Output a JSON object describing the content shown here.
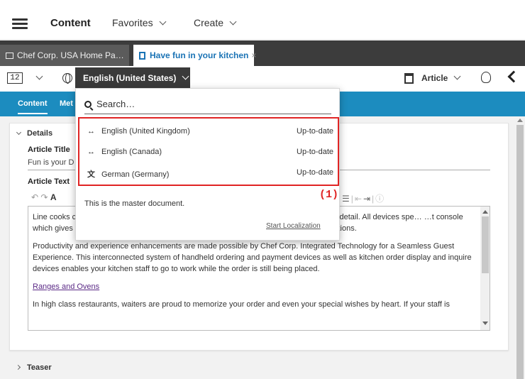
{
  "topnav": {
    "title": "Content",
    "favorites_label": "Favorites",
    "create_label": "Create"
  },
  "tabs": [
    {
      "label": "Chef Corp. USA Home Pa…"
    },
    {
      "label": "Have fun in your kitchen",
      "close": "×"
    }
  ],
  "toolbar": {
    "version_num": "12",
    "language_label": "English (United States)",
    "doc_type_label": "Article"
  },
  "subtabs": [
    {
      "label": "Content"
    },
    {
      "label": "Met"
    }
  ],
  "form": {
    "details_label": "Details",
    "article_title_label": "Article Title",
    "article_title_value": "Fun is your D",
    "article_text_label": "Article Text",
    "editor_paragraphs": [
      "Line cooks c… … then ask the patron. This way, confusion a… …s with your attention to detail. All devices spe… …t console which gives your management unique and aggregated insights into the day-to-day operations.",
      "Productivity and experience enhancements are made possible by Chef Corp. Integrated Technology for a Seamless Guest Experience. This interconnected system of handheld ordering and payment devices as well as kitchen order display and inquire devices enables your kitchen staff to go to work while the order is still being placed."
    ],
    "link_text": "Ranges and Ovens",
    "last_line": "In high class restaurants, waiters are proud to memorize your order and even your special wishes by heart. If your staff is",
    "teaser_label": "Teaser"
  },
  "dropdown": {
    "search_placeholder": "Search…",
    "items": [
      {
        "language": "English (United Kingdom)",
        "status": "Up-to-date",
        "icon": "sync-icon"
      },
      {
        "language": "English (Canada)",
        "status": "Up-to-date",
        "icon": "sync-icon"
      },
      {
        "language": "German (Germany)",
        "status": "Up-to-date",
        "icon": "translate-icon"
      }
    ],
    "note": "This is the master document.",
    "action_label": "Start Localization"
  },
  "annotation": {
    "callout": "(1)"
  },
  "colors": {
    "tab_bar": "#3c3c3c",
    "accent_blue": "#1c8cbf",
    "highlight_red": "#e02424"
  }
}
